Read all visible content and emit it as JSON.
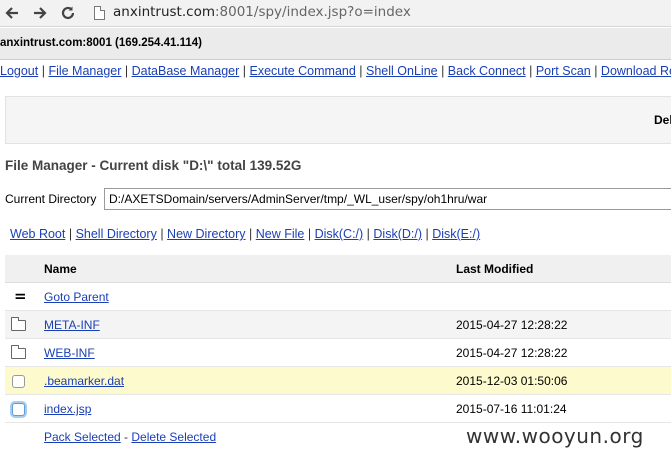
{
  "browser": {
    "url_host": "anxintrust.com",
    "url_path": ":8001/spy/index.jsp?o=index"
  },
  "host_info": "anxintrust.com:8001 (169.254.41.114)",
  "menu": {
    "items": [
      "Logout",
      "File Manager",
      "DataBase Manager",
      "Execute Command",
      "Shell OnLine",
      "Back Connect",
      "Port Scan",
      "Download Remote"
    ]
  },
  "message_box": {
    "text": "Del"
  },
  "file_manager": {
    "title": "File Manager - Current disk \"D:\\\" total 139.52G",
    "current_dir_label": "Current Directory",
    "current_dir_value": "D:/AXETSDomain/servers/AdminServer/tmp/_WL_user/spy/oh1hru/war",
    "tools": [
      "Web Root",
      "Shell Directory",
      "New Directory",
      "New File",
      "Disk(C:/)",
      "Disk(D:/)",
      "Disk(E:/)"
    ],
    "columns": {
      "name": "Name",
      "modified": "Last Modified"
    },
    "goto_parent": {
      "symbol": "=",
      "label": "Goto Parent"
    },
    "rows": [
      {
        "type": "folder",
        "icon": "folder-icon",
        "name": "META-INF",
        "modified": "2015-04-27 12:28:22"
      },
      {
        "type": "folder",
        "icon": "folder-icon",
        "name": "WEB-INF",
        "modified": "2015-04-27 12:28:22"
      },
      {
        "type": "file",
        "name": ".beamarker.dat",
        "modified": "2015-12-03 01:50:06",
        "highlight": true
      },
      {
        "type": "file",
        "name": "index.jsp",
        "modified": "2015-07-16 11:01:24",
        "focused": true
      }
    ],
    "actions": {
      "pack": "Pack Selected",
      "delete": "Delete Selected"
    }
  },
  "watermark": "www.wooyun.org",
  "colors": {
    "link": "#1a3fb5",
    "highlight_row": "#fdfbcd"
  }
}
